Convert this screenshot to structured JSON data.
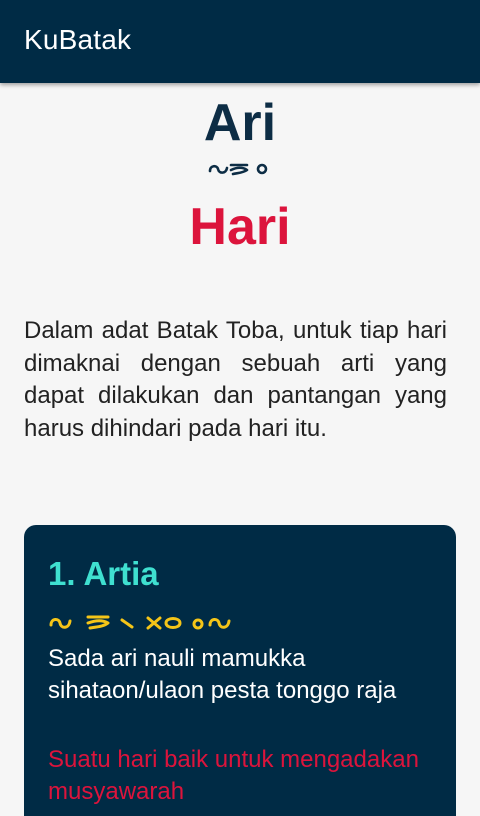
{
  "app_bar": {
    "title": "KuBatak",
    "background": "#002b45"
  },
  "header": {
    "word": "Ari",
    "script_icon": "batak-script-ari",
    "translation": "Hari"
  },
  "intro": {
    "text": "Dalam adat Batak Toba, untuk tiap hari dimaknai dengan sebuah arti yang dapat dilakukan dan pantangan yang harus dihindari pada hari itu."
  },
  "cards": [
    {
      "title": "1. Artia",
      "script_icon": "batak-script-artia",
      "meaning": "Sada ari nauli mamukka sihataon/ulaon pesta tonggo raja",
      "translation": "Suatu hari baik untuk mengadakan musyawarah"
    }
  ],
  "colors": {
    "accent_teal": "#3fe0d0",
    "accent_red": "#dc143c",
    "script_yellow": "#f5c518",
    "card_background": "#002b45"
  }
}
